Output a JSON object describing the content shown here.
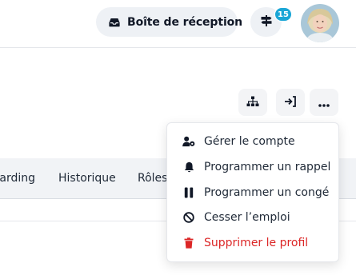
{
  "header": {
    "inbox_label": "Boîte de réception",
    "notification_count": "15",
    "icons": {
      "inbox": "inbox-tray-icon",
      "signpost": "signpost-icon",
      "avatar": "user-avatar"
    }
  },
  "actions": {
    "icons": [
      "org-chart-icon",
      "sign-in-icon",
      "more-horizontal-icon"
    ]
  },
  "tabs": [
    {
      "label": "Onboarding",
      "visible_text": "arding"
    },
    {
      "label": "Historique",
      "visible_text": "Historique"
    },
    {
      "label": "Rôles",
      "visible_text": "Rôles"
    }
  ],
  "menu": {
    "items": [
      {
        "label": "Gérer le compte",
        "icon": "user-cog-icon"
      },
      {
        "label": "Programmer un rappel",
        "icon": "bell-icon"
      },
      {
        "label": "Programmer un congé",
        "icon": "pause-icon"
      },
      {
        "label": "Cesser l’emploi",
        "icon": "ban-icon"
      },
      {
        "label": "Supprimer le profil",
        "icon": "trash-icon",
        "danger": true
      }
    ]
  },
  "colors": {
    "accent": "#1aa6d6",
    "danger": "#dc2626",
    "button_bg": "#eef1f5",
    "tab_bar_bg": "#f1f3f6"
  }
}
